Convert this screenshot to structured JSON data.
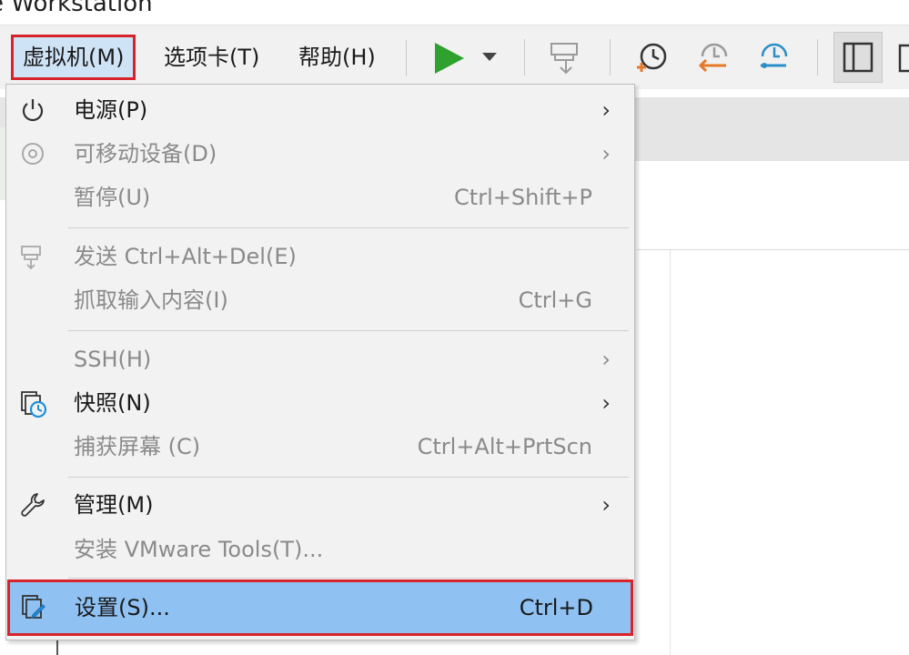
{
  "window": {
    "title": "e Workstation"
  },
  "menubar": {
    "vm_menu": "虚拟机(M)",
    "tabs_menu": "选项卡(T)",
    "help_menu": "帮助(H)"
  },
  "dropdown": {
    "items": [
      {
        "label": "电源(P)",
        "shortcut": "",
        "submenu": true,
        "enabled": true,
        "icon": "power-icon"
      },
      {
        "label": "可移动设备(D)",
        "shortcut": "",
        "submenu": true,
        "enabled": false,
        "icon": "removable-device-icon"
      },
      {
        "label": "暂停(U)",
        "shortcut": "Ctrl+Shift+P",
        "submenu": false,
        "enabled": false,
        "icon": ""
      },
      {
        "label": "发送 Ctrl+Alt+Del(E)",
        "shortcut": "",
        "submenu": false,
        "enabled": false,
        "icon": "send-ctrl-alt-del-icon"
      },
      {
        "label": "抓取输入内容(I)",
        "shortcut": "Ctrl+G",
        "submenu": false,
        "enabled": false,
        "icon": ""
      },
      {
        "label": "SSH(H)",
        "shortcut": "",
        "submenu": true,
        "enabled": false,
        "icon": ""
      },
      {
        "label": "快照(N)",
        "shortcut": "",
        "submenu": true,
        "enabled": true,
        "icon": "snapshot-icon"
      },
      {
        "label": "捕获屏幕 (C)",
        "shortcut": "Ctrl+Alt+PrtScn",
        "submenu": false,
        "enabled": false,
        "icon": ""
      },
      {
        "label": "管理(M)",
        "shortcut": "",
        "submenu": true,
        "enabled": true,
        "icon": "wrench-icon"
      },
      {
        "label": "安装 VMware Tools(T)...",
        "shortcut": "",
        "submenu": false,
        "enabled": false,
        "icon": ""
      },
      {
        "label": "设置(S)...",
        "shortcut": "Ctrl+D",
        "submenu": false,
        "enabled": true,
        "icon": "settings-icon"
      }
    ],
    "submenu_arrow": "›"
  },
  "colors": {
    "highlight": "#8fc1f2",
    "annotation_border": "#d8232a",
    "play_green": "#2ea12e"
  }
}
